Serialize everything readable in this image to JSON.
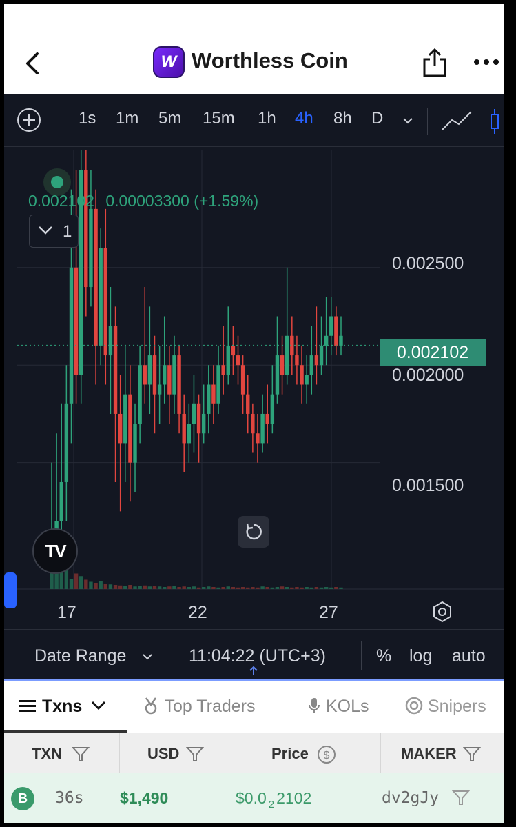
{
  "header": {
    "title": "Worthless Coin",
    "logo_letter": "W"
  },
  "toolbar": {
    "timeframes": [
      "1s",
      "1m",
      "5m",
      "15m",
      "1h",
      "4h",
      "8h",
      "D"
    ],
    "active_timeframe": "4h"
  },
  "chart": {
    "legend_price": "0.002102",
    "legend_change": "0.00003300 (+1.59%)",
    "collapse_count": "1",
    "current_price_tag": "0.002102",
    "y_labels": [
      "0.002500",
      "0.002000",
      "0.001500"
    ],
    "x_labels": [
      "17",
      "22",
      "27"
    ],
    "colors": {
      "up": "#2ea37b",
      "down": "#e2463f",
      "background": "#131722"
    }
  },
  "chart_data": {
    "type": "candlestick",
    "x_ticks": [
      "17",
      "22",
      "27"
    ],
    "y_ticks": [
      0.0025,
      0.002,
      0.0015
    ],
    "last_price": 0.002102,
    "candles": [
      [
        0.00105,
        0.00112,
        0.0015,
        0.00095
      ],
      [
        0.00112,
        0.0012,
        0.00165,
        0.00098
      ],
      [
        0.0012,
        0.0014,
        0.0018,
        0.0011
      ],
      [
        0.0014,
        0.0018,
        0.002,
        0.0012
      ],
      [
        0.0018,
        0.0025,
        0.0029,
        0.0016
      ],
      [
        0.0025,
        0.00195,
        0.003,
        0.0018
      ],
      [
        0.00195,
        0.003,
        0.0032,
        0.0018
      ],
      [
        0.003,
        0.0024,
        0.0032,
        0.00225
      ],
      [
        0.0024,
        0.0028,
        0.003,
        0.0023
      ],
      [
        0.0028,
        0.0021,
        0.0029,
        0.0019
      ],
      [
        0.0021,
        0.0026,
        0.0027,
        0.002
      ],
      [
        0.0026,
        0.00205,
        0.0028,
        0.0019
      ],
      [
        0.00205,
        0.0022,
        0.0024,
        0.00175
      ],
      [
        0.0022,
        0.00175,
        0.0023,
        0.0014
      ],
      [
        0.00175,
        0.0016,
        0.00195,
        0.00125
      ],
      [
        0.0016,
        0.00185,
        0.0021,
        0.0014
      ],
      [
        0.00185,
        0.0015,
        0.002,
        0.0013
      ],
      [
        0.0015,
        0.0017,
        0.0018,
        0.00135
      ],
      [
        0.0017,
        0.002,
        0.0021,
        0.0016
      ],
      [
        0.002,
        0.0019,
        0.0024,
        0.0018
      ],
      [
        0.0019,
        0.00205,
        0.0023,
        0.00175
      ],
      [
        0.00205,
        0.00185,
        0.00215,
        0.00165
      ],
      [
        0.00185,
        0.0019,
        0.0021,
        0.0017
      ],
      [
        0.0019,
        0.002,
        0.00225,
        0.0018
      ],
      [
        0.002,
        0.00185,
        0.0021,
        0.0017
      ],
      [
        0.00185,
        0.00205,
        0.00215,
        0.00175
      ],
      [
        0.00205,
        0.00175,
        0.0021,
        0.00165
      ],
      [
        0.00175,
        0.0016,
        0.00185,
        0.00145
      ],
      [
        0.0016,
        0.0017,
        0.0018,
        0.0015
      ],
      [
        0.0017,
        0.0018,
        0.00195,
        0.00155
      ],
      [
        0.0018,
        0.00165,
        0.00185,
        0.0015
      ],
      [
        0.00165,
        0.00175,
        0.0019,
        0.0016
      ],
      [
        0.00175,
        0.0019,
        0.002,
        0.00165
      ],
      [
        0.0019,
        0.0018,
        0.002,
        0.0017
      ],
      [
        0.0018,
        0.002,
        0.0021,
        0.00175
      ],
      [
        0.002,
        0.00195,
        0.0022,
        0.00185
      ],
      [
        0.00195,
        0.0021,
        0.0023,
        0.0019
      ],
      [
        0.0021,
        0.00205,
        0.0022,
        0.00195
      ],
      [
        0.00205,
        0.002,
        0.00215,
        0.0019
      ],
      [
        0.002,
        0.00185,
        0.00205,
        0.00175
      ],
      [
        0.00185,
        0.00175,
        0.00195,
        0.00165
      ],
      [
        0.00175,
        0.00165,
        0.0018,
        0.00155
      ],
      [
        0.00165,
        0.0016,
        0.00175,
        0.0015
      ],
      [
        0.0016,
        0.00175,
        0.00185,
        0.00155
      ],
      [
        0.00175,
        0.0017,
        0.0019,
        0.0016
      ],
      [
        0.0017,
        0.00185,
        0.002,
        0.00165
      ],
      [
        0.00185,
        0.00205,
        0.00225,
        0.0018
      ],
      [
        0.00205,
        0.00195,
        0.00215,
        0.00185
      ],
      [
        0.00195,
        0.00215,
        0.0025,
        0.0019
      ],
      [
        0.00215,
        0.00205,
        0.00225,
        0.00195
      ],
      [
        0.00205,
        0.002,
        0.00215,
        0.0019
      ],
      [
        0.002,
        0.0019,
        0.0021,
        0.0018
      ],
      [
        0.0019,
        0.00195,
        0.00205,
        0.0018
      ],
      [
        0.00195,
        0.00205,
        0.0022,
        0.00185
      ],
      [
        0.00205,
        0.002,
        0.0023,
        0.0019
      ],
      [
        0.002,
        0.0021,
        0.00225,
        0.00195
      ],
      [
        0.0021,
        0.00215,
        0.00235,
        0.002
      ],
      [
        0.00215,
        0.00225,
        0.00235,
        0.00205
      ],
      [
        0.00225,
        0.0021,
        0.0023,
        0.00205
      ],
      [
        0.0021,
        0.00215,
        0.00225,
        0.00205
      ]
    ],
    "volumes": [
      60,
      55,
      80,
      40,
      20,
      30,
      25,
      18,
      14,
      12,
      16,
      10,
      9,
      8,
      7,
      6,
      8,
      5,
      6,
      7,
      5,
      6,
      5,
      4,
      5,
      6,
      4,
      5,
      4,
      5,
      3,
      4,
      5,
      4,
      3,
      4,
      5,
      4,
      3,
      4,
      3,
      4,
      3,
      5,
      4,
      3,
      4,
      5,
      4,
      3,
      4,
      3,
      4,
      3,
      4,
      3,
      4,
      3,
      4,
      3
    ]
  },
  "footer": {
    "date_range": "Date Range",
    "clock": "11:04:22 (UTC+3)",
    "percent": "%",
    "log": "log",
    "auto": "auto"
  },
  "tabs": [
    {
      "label": "Txns",
      "active": true
    },
    {
      "label": "Top Traders",
      "active": false
    },
    {
      "label": "KOLs",
      "active": false
    },
    {
      "label": "Snipers",
      "active": false
    }
  ],
  "table": {
    "headers": {
      "txn": "TXN",
      "usd": "USD",
      "price": "Price",
      "maker": "MAKER"
    },
    "rows": [
      {
        "type": "B",
        "age": "36s",
        "usd": "$1,490",
        "price_prefix": "$0.0",
        "price_sub": "2",
        "price_rest": "2102",
        "maker": "dv2gJy"
      }
    ]
  }
}
